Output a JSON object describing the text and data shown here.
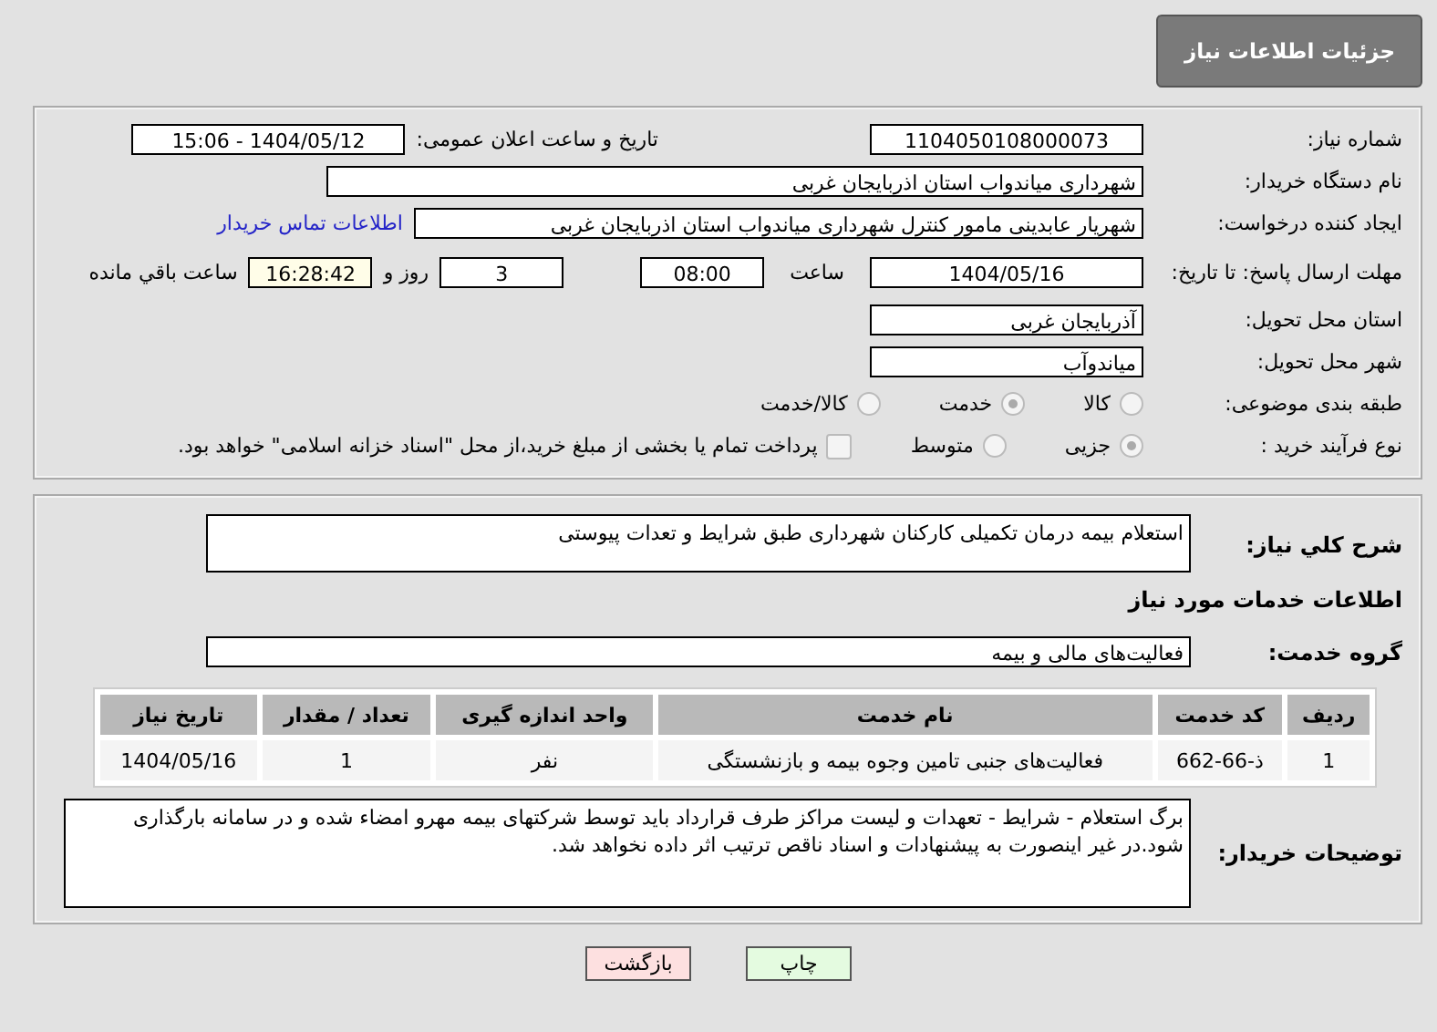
{
  "header": {
    "title": "جزئیات اطلاعات نیاز"
  },
  "need_number": {
    "label": "شماره نیاز:",
    "value": "1104050108000073"
  },
  "announce": {
    "label": "تاریخ و ساعت اعلان عمومی:",
    "value": "1404/05/12 - 15:06"
  },
  "buyer": {
    "label": "نام دستگاه خریدار:",
    "value": "شهرداری میاندواب استان اذربایجان غربی"
  },
  "creator": {
    "label": "ایجاد کننده درخواست:",
    "value": "شهریار  عابدینی مامور کنترل شهرداری میاندواب استان اذربایجان غربی",
    "link": "اطلاعات تماس خریدار"
  },
  "deadline": {
    "label": "مهلت ارسال پاسخ: تا تاریخ:",
    "date": "1404/05/16",
    "time_label": "ساعت",
    "time": "08:00",
    "days": "3",
    "days_label": "روز و",
    "remaining": "16:28:42",
    "remaining_label": "ساعت باقي مانده"
  },
  "province": {
    "label": "استان محل تحویل:",
    "value": "آذربایجان غربی"
  },
  "city": {
    "label": "شهر محل تحویل:",
    "value": "میاندوآب"
  },
  "category": {
    "label": "طبقه بندی موضوعی:",
    "options": [
      {
        "label": "کالا",
        "selected": false
      },
      {
        "label": "خدمت",
        "selected": true
      },
      {
        "label": "کالا/خدمت",
        "selected": false
      }
    ]
  },
  "process": {
    "label": "نوع فرآیند خرید :",
    "options": [
      {
        "label": "جزیی",
        "selected": true
      },
      {
        "label": "متوسط",
        "selected": false
      }
    ],
    "treasury": {
      "label": "پرداخت تمام یا بخشی از مبلغ خرید،از محل \"اسناد خزانه اسلامی\" خواهد بود.",
      "checked": false
    }
  },
  "description": {
    "label": "شرح کلي نياز:",
    "value": "استعلام بیمه درمان تکمیلی کارکنان شهرداری طبق شرایط و تعدات پیوستی"
  },
  "services_heading": "اطلاعات خدمات مورد نیاز",
  "service_group": {
    "label": "گروه خدمت:",
    "value": "فعالیت‌های مالی و بیمه"
  },
  "table": {
    "columns": [
      "ردیف",
      "کد خدمت",
      "نام خدمت",
      "واحد اندازه گیری",
      "تعداد / مقدار",
      "تاریخ نیاز"
    ],
    "rows": [
      [
        "1",
        "ذ-66-662",
        "فعالیت‌های جنبی تامین وجوه بیمه و بازنشستگی",
        "نفر",
        "1",
        "1404/05/16"
      ]
    ]
  },
  "buyer_notes": {
    "label": "توضیحات خریدار:",
    "value": "برگ استعلام - شرایط - تعهدات و لیست مراکز طرف قرارداد باید توسط شرکتهای بیمه مهرو امضاء شده و در سامانه بارگذاری شود.در غیر اینصورت به پیشنهادات و اسناد ناقص ترتیب اثر داده نخواهد شد."
  },
  "buttons": {
    "print": "چاپ",
    "back": "بازگشت"
  }
}
